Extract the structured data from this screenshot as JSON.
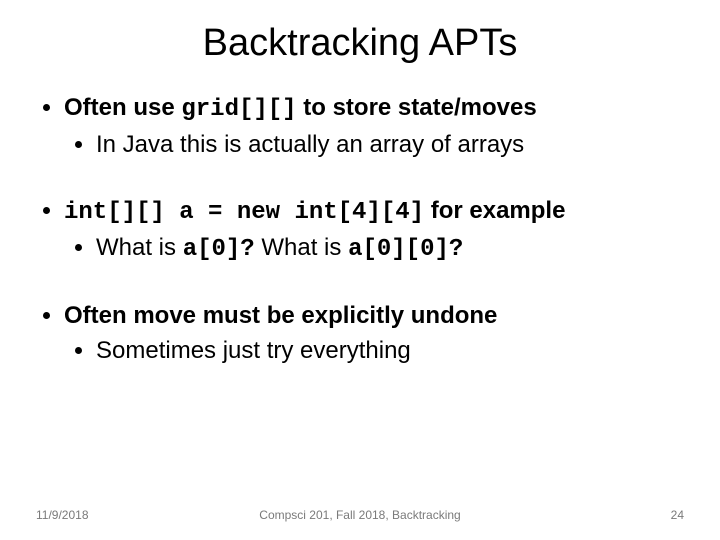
{
  "title": "Backtracking APTs",
  "bullets": [
    {
      "pre": "Often use ",
      "code": "grid[][]",
      "post": " to store state/moves",
      "sub": [
        "In Java this is actually an array of arrays"
      ]
    },
    {
      "code": "int[][] a = new int[4][4]",
      "post": " for example",
      "sub": [
        {
          "t1": "What is ",
          "c1": "a[0]?",
          "t2": "  What is ",
          "c2": "a[0][0]?"
        }
      ]
    },
    {
      "text": "Often move must be explicitly undone",
      "sub": [
        "Sometimes just try everything"
      ]
    }
  ],
  "footer": {
    "date": "11/9/2018",
    "course": "Compsci 201, Fall 2018,  Backtracking",
    "page": "24"
  }
}
